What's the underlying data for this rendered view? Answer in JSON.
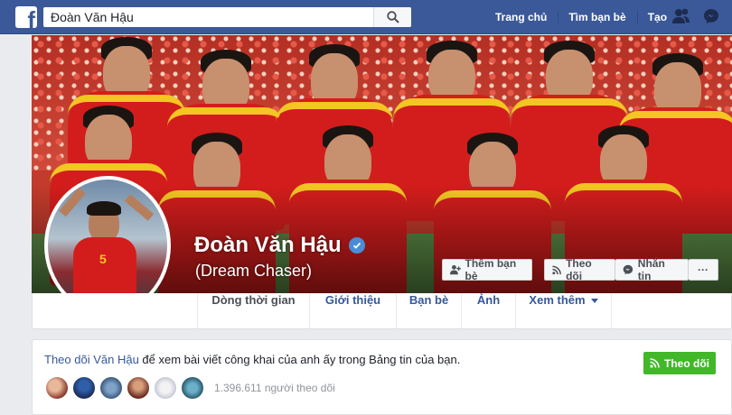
{
  "search": {
    "value": "Đoàn Văn Hậu"
  },
  "nav": {
    "home": "Trang chủ",
    "find_friends": "Tìm bạn bè",
    "create": "Tạo"
  },
  "profile": {
    "name": "Đoàn Văn Hậu",
    "nickname": "(Dream Chaser)",
    "jersey_number": "5"
  },
  "actions": {
    "add_friend": "Thêm bạn bè",
    "follow": "Theo dõi",
    "message": "Nhắn tin",
    "more": "···"
  },
  "tabs": [
    {
      "label": "Dòng thời gian"
    },
    {
      "label": "Giới thiệu"
    },
    {
      "label": "Bạn bè"
    },
    {
      "label": "Ảnh"
    },
    {
      "label": "Xem thêm"
    }
  ],
  "follow_prompt": {
    "link": "Theo dõi Văn Hậu",
    "text": " để xem bài viết công khai của anh ấy trong Bảng tin của bạn.",
    "button": "Theo dõi",
    "followers": "1.396.611 người theo dõi"
  },
  "colors": {
    "brand": "#3b5998",
    "link": "#365899",
    "follow_green": "#42b72a",
    "jersey_red": "#d31d1c",
    "jersey_yellow": "#f3c623"
  }
}
